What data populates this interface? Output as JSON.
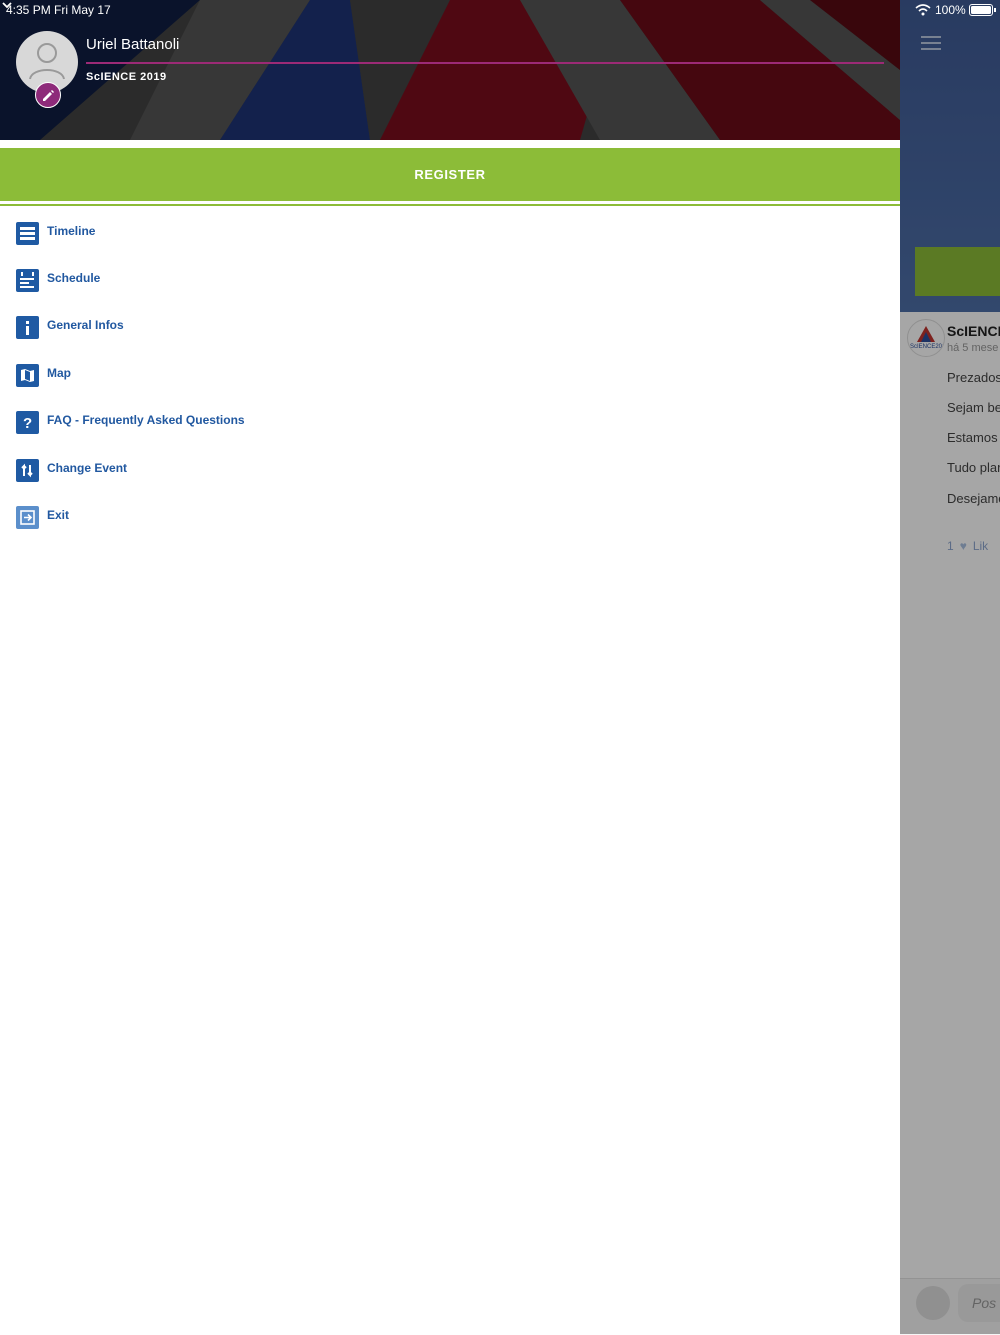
{
  "status_bar": {
    "time": "4:35 PM   Fri May 17",
    "battery": "100%"
  },
  "drawer": {
    "user_name": "Uriel Battanoli",
    "event_name": "ScIENCE 2019",
    "register_label": "REGISTER",
    "menu": [
      {
        "label": "Timeline",
        "icon": "timeline-icon"
      },
      {
        "label": "Schedule",
        "icon": "schedule-icon"
      },
      {
        "label": "General Infos",
        "icon": "info-icon"
      },
      {
        "label": "Map",
        "icon": "map-icon"
      },
      {
        "label": "FAQ - Frequently Asked Questions",
        "icon": "question-icon"
      },
      {
        "label": "Change Event",
        "icon": "swap-icon"
      },
      {
        "label": "Exit",
        "icon": "exit-icon"
      }
    ]
  },
  "background_feed": {
    "post_author": "ScIENCE",
    "post_time": "há 5 mese",
    "lines": [
      "Prezados",
      "Sejam be",
      "Estamos",
      "Tudo plar",
      "Desejamo"
    ],
    "like_count": "1",
    "like_label": "Lik",
    "post_placeholder": "Pos"
  },
  "colors": {
    "accent_green": "#8cbc38",
    "menu_blue": "#2158a0",
    "underline_purple": "#9c2a76"
  }
}
